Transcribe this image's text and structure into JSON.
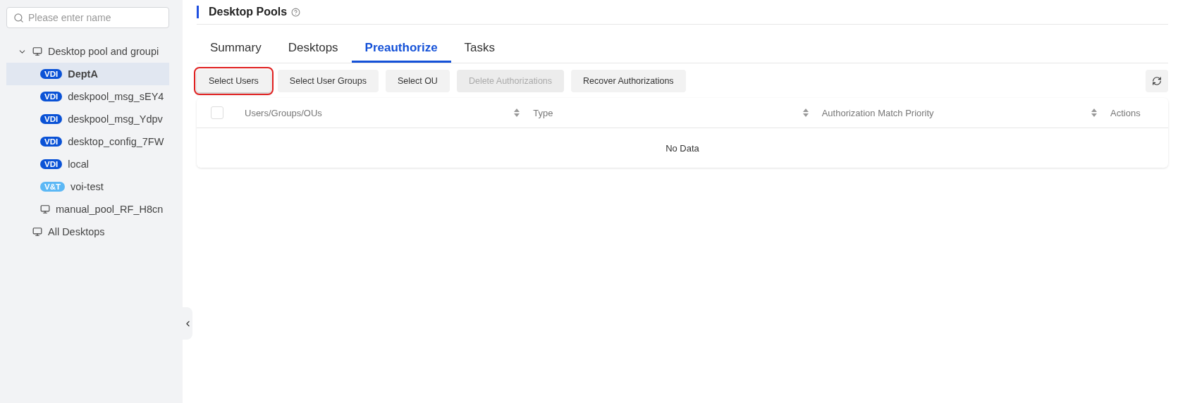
{
  "sidebar": {
    "search": {
      "placeholder": "Please enter name"
    },
    "tree": [
      {
        "label": "Desktop pool and groupi",
        "kind": "desktop",
        "expanded": true,
        "selected": false,
        "children": [
          {
            "label": "DeptA",
            "kind": "pool",
            "badge": "VDI",
            "color": "#0a52d6",
            "selected": true
          },
          {
            "label": "deskpool_msg_sEY4",
            "kind": "pool",
            "badge": "VDI",
            "color": "#0a52d6",
            "selected": false
          },
          {
            "label": "deskpool_msg_Ydpv",
            "kind": "pool",
            "badge": "VDI",
            "color": "#0a52d6",
            "selected": false
          },
          {
            "label": "desktop_config_7FW",
            "kind": "pool",
            "badge": "VDI",
            "color": "#0a52d6",
            "selected": false
          },
          {
            "label": "local",
            "kind": "pool",
            "badge": "VDI",
            "color": "#0a52d6",
            "selected": false
          },
          {
            "label": "voi-test",
            "kind": "pool",
            "badge": "V&T",
            "color": "#5cb8f5",
            "selected": false
          },
          {
            "label": "manual_pool_RF_H8cn",
            "kind": "desktop",
            "selected": false
          }
        ]
      },
      {
        "label": "All Desktops",
        "kind": "desktop",
        "selected": false
      }
    ]
  },
  "page": {
    "title": "Desktop Pools"
  },
  "tabs": [
    {
      "label": "Summary",
      "selected": false
    },
    {
      "label": "Desktops",
      "selected": false
    },
    {
      "label": "Preauthorize",
      "selected": true
    },
    {
      "label": "Tasks",
      "selected": false
    }
  ],
  "toolbar": [
    {
      "label": "Select Users",
      "disabled": false,
      "highlighted": true
    },
    {
      "label": "Select User Groups",
      "disabled": false,
      "highlighted": false
    },
    {
      "label": "Select OU",
      "disabled": false,
      "highlighted": false
    },
    {
      "label": "Delete Authorizations",
      "disabled": true,
      "highlighted": false
    },
    {
      "label": "Recover Authorizations",
      "disabled": false,
      "highlighted": false
    }
  ],
  "table": {
    "select_all_checked": false,
    "columns": [
      {
        "label": "Users/Groups/OUs",
        "sortable": true
      },
      {
        "label": "Type",
        "sortable": true
      },
      {
        "label": "Authorization Match Priority",
        "sortable": true
      },
      {
        "label": "Actions",
        "sortable": false
      }
    ],
    "empty_text": "No Data"
  }
}
